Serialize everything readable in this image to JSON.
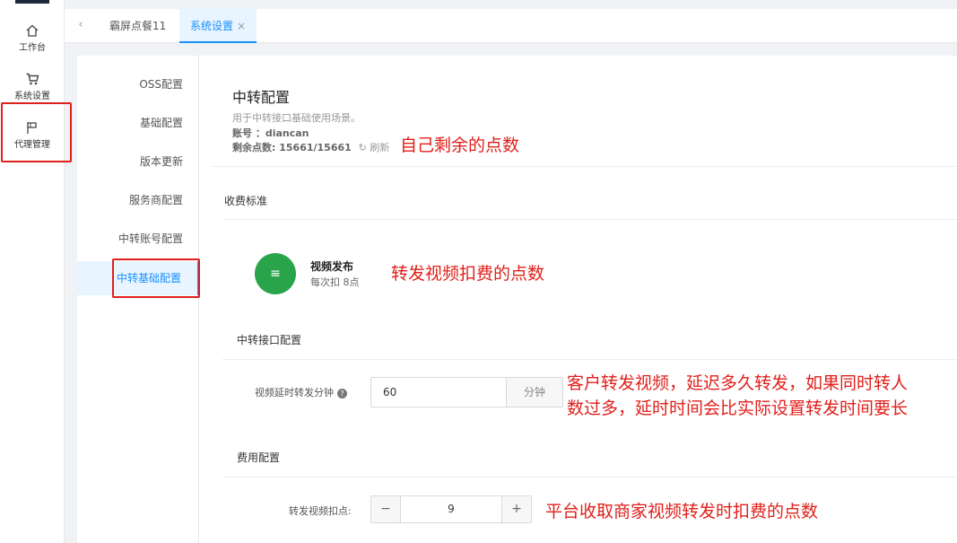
{
  "rail": {
    "items": [
      {
        "label": "工作台",
        "icon": "home-icon"
      },
      {
        "label": "系统设置",
        "icon": "cart-icon"
      },
      {
        "label": "代理管理",
        "icon": "flag-icon"
      }
    ]
  },
  "tabs": {
    "items": [
      {
        "label": "霸屏点餐11"
      },
      {
        "label": "系统设置",
        "close": "×"
      }
    ]
  },
  "menu": {
    "items": [
      {
        "label": "OSS配置"
      },
      {
        "label": "基础配置"
      },
      {
        "label": "版本更新"
      },
      {
        "label": "服务商配置"
      },
      {
        "label": "中转账号配置"
      },
      {
        "label": "中转基础配置"
      }
    ]
  },
  "header": {
    "title": "中转配置",
    "desc": "用于中转接口基础使用场景。",
    "account": "账号 ：diancan",
    "points": "剩余点数: 15661/15661",
    "refresh": "刷新"
  },
  "fee_standard": {
    "section_title": "收费标准",
    "item_title": "视频发布",
    "item_sub": "每次扣 8点"
  },
  "relay_config": {
    "section_title": "中转接口配置",
    "delay_label": "视频延时转发分钟",
    "delay_value": "60",
    "delay_unit": "分钟"
  },
  "cost_config": {
    "section_title": "费用配置",
    "deduct_label": "转发视频扣点:",
    "deduct_value": "9",
    "minus": "−",
    "plus": "+"
  },
  "annotations": {
    "points_note": "自己剩余的点数",
    "fee_note": "转发视频扣费的点数",
    "delay_note_1": "客户转发视频，延迟多久转发，如果同时转人",
    "delay_note_2": "数过多，延时时间会比实际设置转发时间要长",
    "deduct_note": "平台收取商家视频转发时扣费的点数"
  },
  "colors": {
    "accent": "#1890ff",
    "annotation": "#e0201b",
    "fee_icon": "#2aa44a"
  }
}
